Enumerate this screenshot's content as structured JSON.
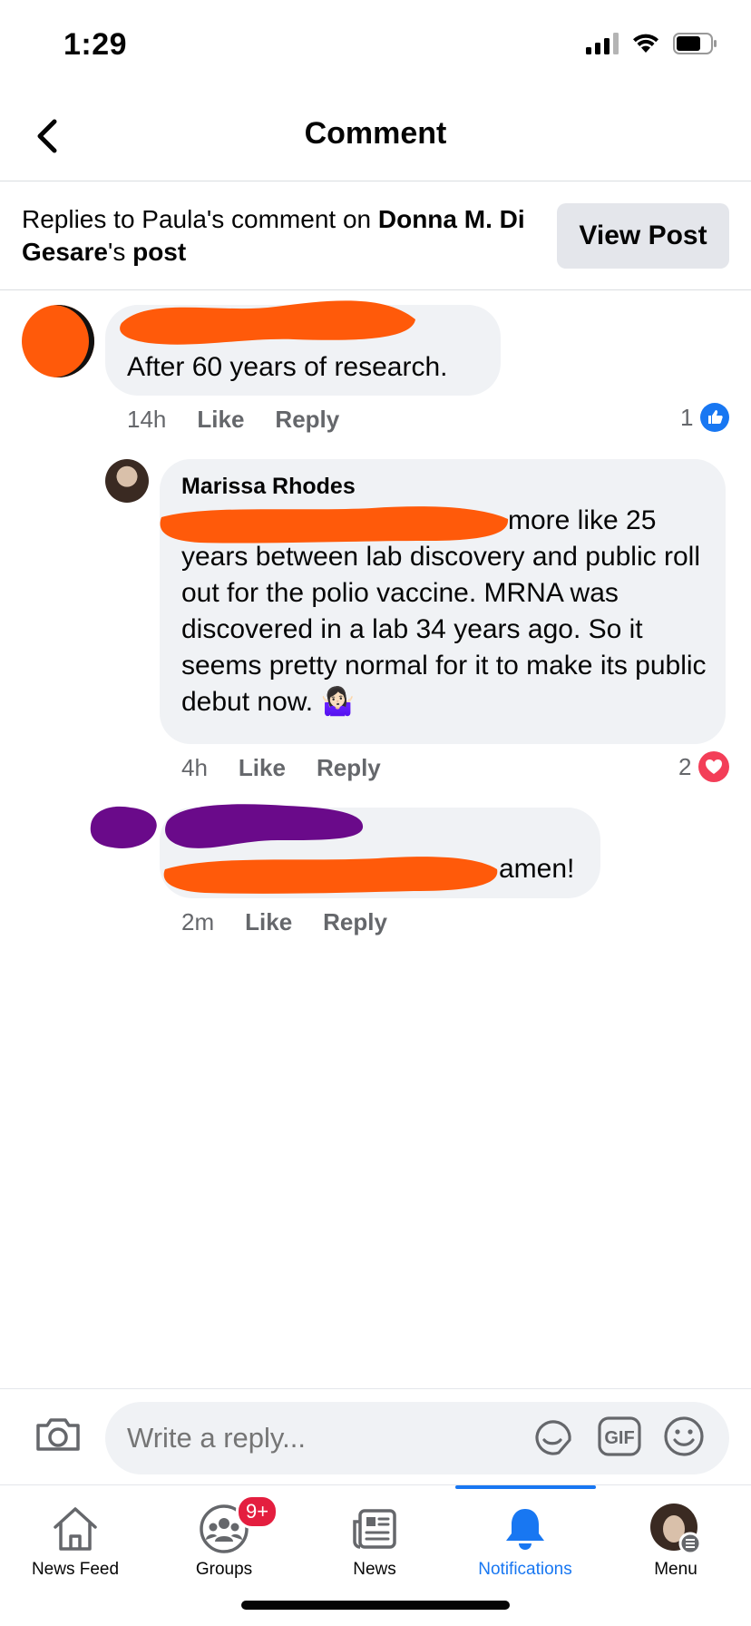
{
  "status_bar": {
    "time": "1:29"
  },
  "header": {
    "title": "Comment"
  },
  "context": {
    "prefix": "Replies to Paula's comment on ",
    "post_owner_bold": "Donna M. Di Gesare",
    "suffix_a": "'s ",
    "suffix_bold": "post",
    "view_post_label": "View Post"
  },
  "comments": [
    {
      "text": "After 60 years of research.",
      "time": "14h",
      "like_label": "Like",
      "reply_label": "Reply",
      "reaction_count": "1",
      "reaction": "like"
    },
    {
      "author": "Marissa Rhodes",
      "line1": "more like 25",
      "rest": "years between lab discovery and public roll out for the polio vaccine. MRNA was discovered in a lab 34 years ago. So it seems pretty normal for it to make its public debut now. 🤷🏻‍♀️",
      "time": "4h",
      "like_label": "Like",
      "reply_label": "Reply",
      "reaction_count": "2",
      "reaction": "love"
    },
    {
      "text": "amen!",
      "time": "2m",
      "like_label": "Like",
      "reply_label": "Reply"
    }
  ],
  "composer": {
    "placeholder": "Write a reply..."
  },
  "tabs": [
    {
      "label": "News Feed",
      "icon": "home-icon"
    },
    {
      "label": "Groups",
      "icon": "groups-icon",
      "badge": "9+"
    },
    {
      "label": "News",
      "icon": "news-icon"
    },
    {
      "label": "Notifications",
      "icon": "bell-icon",
      "active": true
    },
    {
      "label": "Menu",
      "icon": "profile-avatar"
    }
  ],
  "colors": {
    "accent": "#1877f2",
    "scribble_orange": "#ff5a0a",
    "scribble_purple": "#6a0a8a",
    "bubble": "#f0f2f5",
    "badge": "#e41e3f",
    "love": "#f33e58"
  }
}
